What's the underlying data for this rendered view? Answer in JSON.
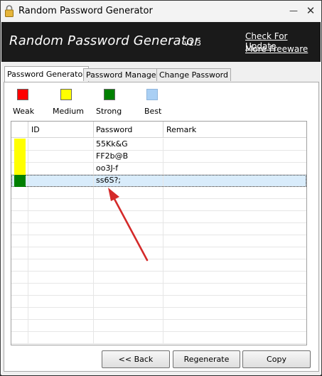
{
  "window": {
    "title": "Random Password Generator",
    "minimize_glyph": "—",
    "close_glyph": "✕"
  },
  "banner": {
    "title": "Random Password Generator",
    "version": "v1.3",
    "link_update": "Check For Update",
    "link_freeware": "More Freeware"
  },
  "tabs": [
    {
      "label": "Password Generator",
      "active": true
    },
    {
      "label": "Password Manager",
      "active": false
    },
    {
      "label": "Change Password",
      "active": false
    }
  ],
  "legend": [
    {
      "label": "Weak",
      "color": "#ff0000"
    },
    {
      "label": "Medium",
      "color": "#ffff00"
    },
    {
      "label": "Strong",
      "color": "#008000"
    },
    {
      "label": "Best",
      "color": "#a9cff4"
    }
  ],
  "grid": {
    "columns": [
      "ID",
      "Password",
      "Remark"
    ],
    "rows": [
      {
        "strength": "Medium",
        "color": "#ffff00",
        "id": "",
        "password": "55Kk&G",
        "remark": ""
      },
      {
        "strength": "Medium",
        "color": "#ffff00",
        "id": "",
        "password": "FF2b@B",
        "remark": ""
      },
      {
        "strength": "Medium",
        "color": "#ffff00",
        "id": "",
        "password": "oo3J-f",
        "remark": ""
      },
      {
        "strength": "Strong",
        "color": "#008000",
        "id": "",
        "password": "ss6S?;",
        "remark": "",
        "selected": true
      }
    ]
  },
  "buttons": {
    "back": "<< Back",
    "regenerate": "Regenerate",
    "copy": "Copy"
  },
  "annotation": {
    "arrow_color": "#d42a2a"
  }
}
